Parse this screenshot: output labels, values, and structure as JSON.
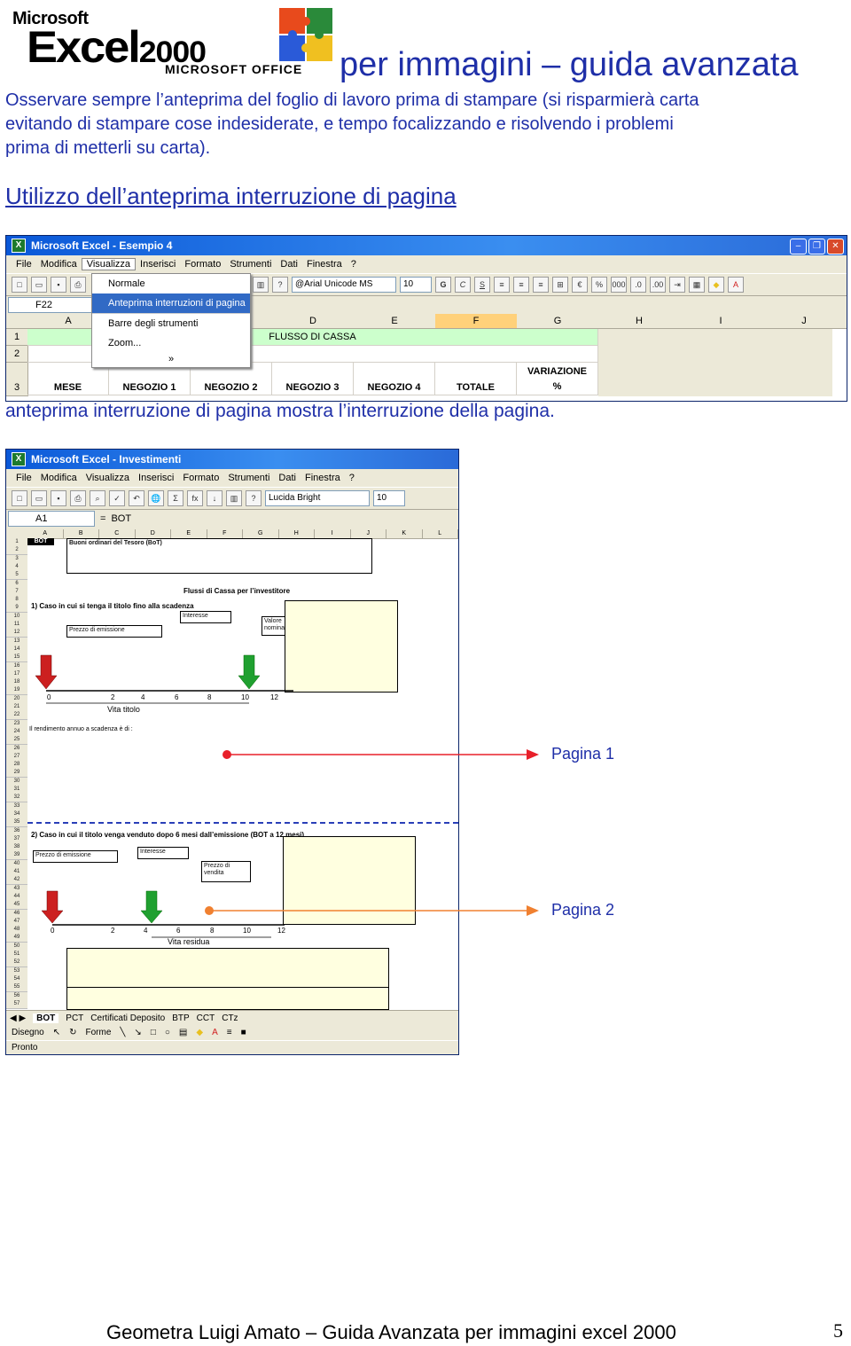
{
  "header": {
    "logo_top": "Microsoft",
    "logo_main": "Excel",
    "logo_version": "2000",
    "logo_sub": "MICROSOFT OFFICE",
    "title": "per immagini – guida avanzata"
  },
  "intro": {
    "line1": "Osservare sempre l’anteprima del foglio di lavoro prima di stampare (si risparmierà carta",
    "line2": "evitando di stampare cose indesiderate, e tempo focalizzando e risolvendo i problemi",
    "line3": "prima di metterli su carta)."
  },
  "section_title": "Utilizzo dell’anteprima interruzione di pagina",
  "window1": {
    "title": "Microsoft Excel - Esempio 4",
    "menu": [
      "File",
      "Modifica",
      "Visualizza",
      "Inserisci",
      "Formato",
      "Strumenti",
      "Dati",
      "Finestra",
      "?"
    ],
    "font_name": "@Arial Unicode MS",
    "font_size": "10",
    "name_box": "F22",
    "columns": [
      "A",
      "B",
      "C",
      "D",
      "E",
      "F",
      "G",
      "H",
      "I",
      "J"
    ],
    "rows": [
      "1",
      "2",
      "3"
    ],
    "flusso": "FLUSSO DI CASSA",
    "headers": [
      "MESE",
      "NEGOZIO 1",
      "NEGOZIO 2",
      "NEGOZIO 3",
      "NEGOZIO 4",
      "TOTALE"
    ],
    "variazione_1": "VARIAZIONE",
    "variazione_2": "%",
    "dropdown": [
      "Normale",
      "Anteprima interruzioni di pagina",
      "Barre degli strumenti",
      "Zoom...",
      "»"
    ]
  },
  "caption": "anteprima interruzione di pagina mostra l’interruzione della pagina.",
  "window2": {
    "title": "Microsoft Excel - Investimenti",
    "menu": [
      "File",
      "Modifica",
      "Visualizza",
      "Inserisci",
      "Formato",
      "Strumenti",
      "Dati",
      "Finestra",
      "?"
    ],
    "font_name": "Lucida Bright",
    "font_size": "10",
    "name_box": "A1",
    "formula": "BOT",
    "columns": [
      "A",
      "B",
      "C",
      "D",
      "E",
      "F",
      "G",
      "H",
      "I",
      "J",
      "K",
      "L"
    ],
    "cell_a1": "BOT",
    "box_top_title": "Buoni ordinari del Tesoro (BoT)",
    "flussi": "Flussi di Cassa per l’investitore",
    "case1": "1) Caso in cui si tenga il titolo fino alla scadenza",
    "case2": "2) Caso in cui il titolo venga venduto dopo 6 mesi dall’emissione (BOT a 12 mesi)",
    "prezzo_emissione": "Prezzo di emissione",
    "interesse": "Interesse",
    "valore_nominale": "Valore nominale",
    "prezzo_vendita": "Prezzo di vendita",
    "vita_titolo": "Vita titolo",
    "vita_residua": "Vita residua",
    "rendimento": "Il rendimento annuo a scadenza è di :",
    "axis1": [
      "0",
      "2",
      "4",
      "6",
      "8",
      "10",
      "12"
    ],
    "axis2": [
      "0",
      "2",
      "4",
      "6",
      "8",
      "10",
      "12"
    ],
    "tabs": [
      "BOT",
      "PCT",
      "Certificati Deposito",
      "BTP",
      "CCT",
      "CTz"
    ],
    "draw_label": "Disegno",
    "forme_label": "Forme",
    "status": "Pronto"
  },
  "annotations": {
    "pagina1": "Pagina 1",
    "pagina2": "Pagina 2",
    "color1": "#e8202a",
    "color2": "#f08030"
  },
  "footer": {
    "text": "Geometra Luigi Amato – Guida Avanzata per immagini excel 2000",
    "page": "5"
  }
}
